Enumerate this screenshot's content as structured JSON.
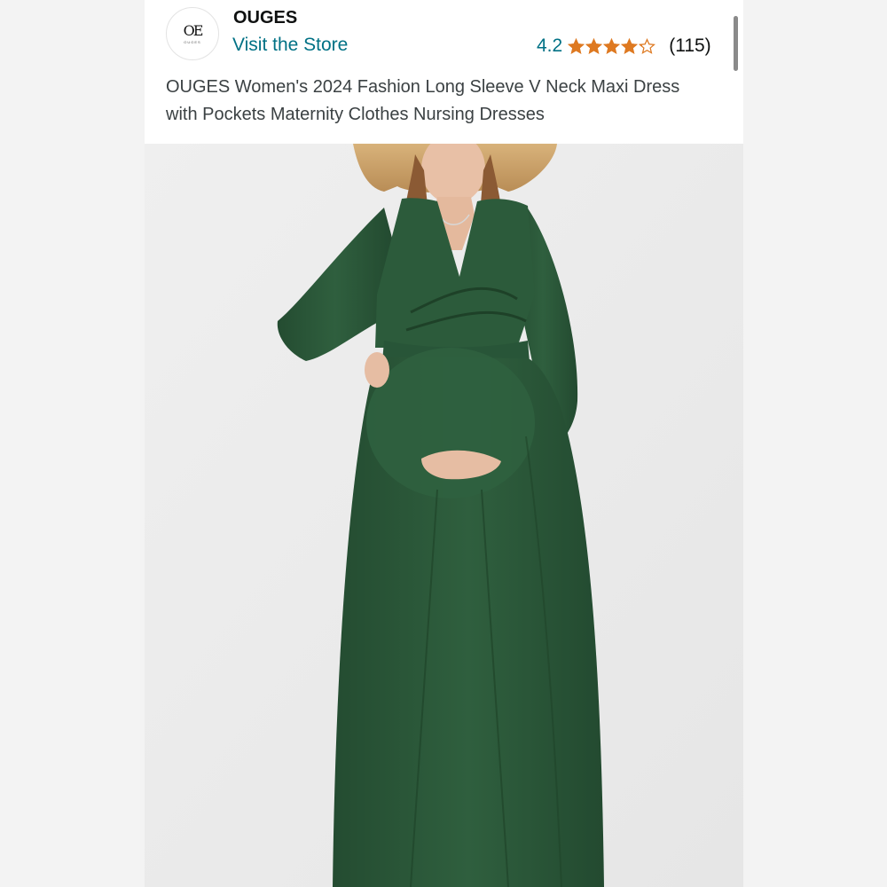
{
  "brand": {
    "name": "OUGES",
    "logo_mark": "OE",
    "logo_small": "OUGES",
    "store_link": "Visit the Store"
  },
  "rating": {
    "score": "4.2",
    "stars_value": 4.2,
    "stars_max": 5,
    "count": "(115)",
    "star_color": "#de7921"
  },
  "product": {
    "title": "OUGES Women's 2024 Fashion Long Sleeve V Neck Maxi Dress with Pockets Maternity Clothes Nursing Dresses"
  },
  "image": {
    "subject": "product-photo",
    "dress_color": "#2d5a3b"
  },
  "colors": {
    "link": "#007185",
    "text": "#0f1111",
    "star": "#de7921"
  }
}
